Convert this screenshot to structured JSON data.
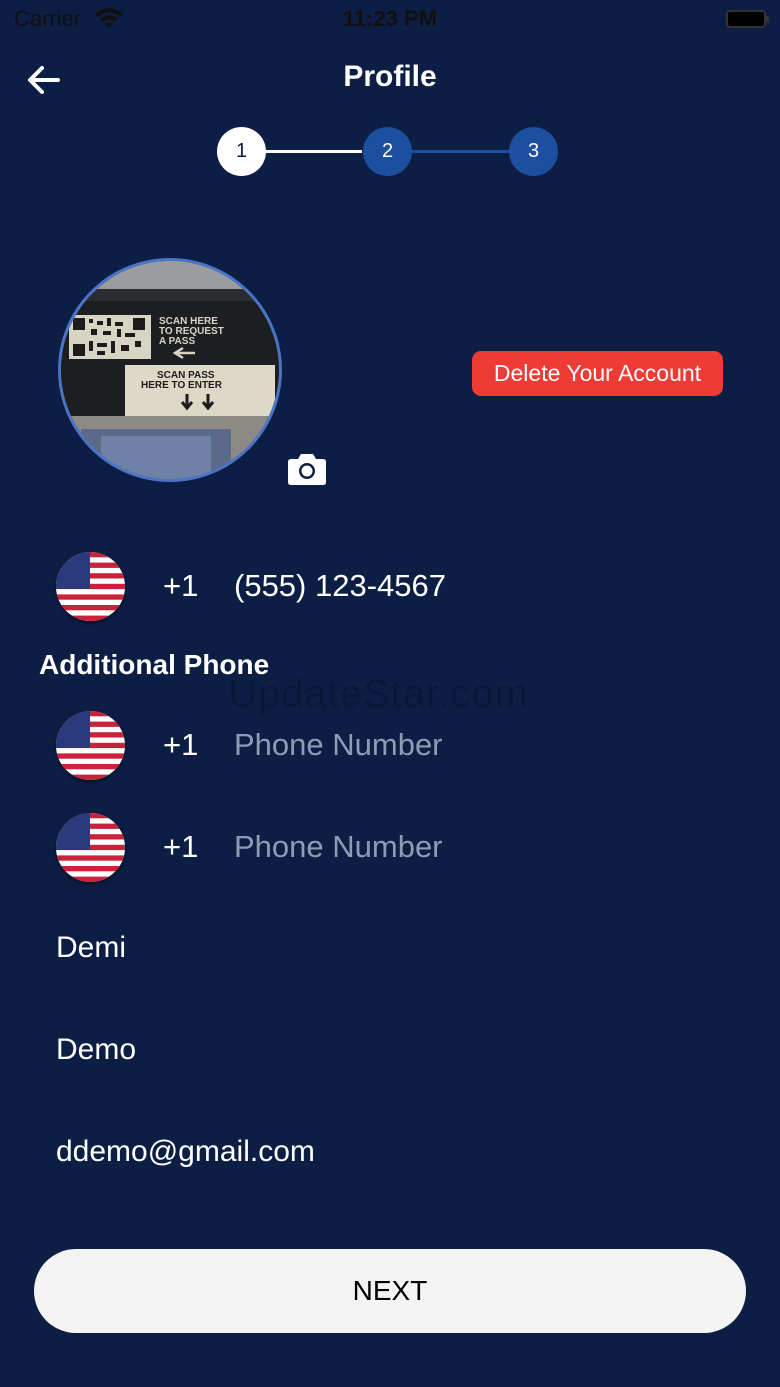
{
  "status_bar": {
    "carrier": "Carrier",
    "time": "11:23 PM"
  },
  "header": {
    "title": "Profile"
  },
  "stepper": {
    "steps": [
      "1",
      "2",
      "3"
    ],
    "current_step": 1
  },
  "avatar": {
    "photo_text_top": [
      "SCAN HERE",
      "TO REQUEST",
      "A PASS"
    ],
    "photo_text_bottom": [
      "SCAN PASS",
      "HERE TO ENTER"
    ]
  },
  "delete_account_label": "Delete Your Account",
  "primary_phone": {
    "country_code": "+1",
    "value": "(555) 123-4567"
  },
  "additional_phone": {
    "section_label": "Additional Phone",
    "entries": [
      {
        "country_code": "+1",
        "value": "",
        "placeholder": "Phone Number"
      },
      {
        "country_code": "+1",
        "value": "",
        "placeholder": "Phone Number"
      }
    ]
  },
  "watermark": "UpdateStar.com",
  "fields": {
    "first_name": "Demi",
    "last_name": "Demo",
    "email": "ddemo@gmail.com"
  },
  "next_label": "NEXT",
  "colors": {
    "background": "#0d1e45",
    "step_active": "#ffffff",
    "step_inactive": "#1d4fa0",
    "delete_button": "#ef3b36",
    "next_button": "#f4f4f4"
  }
}
